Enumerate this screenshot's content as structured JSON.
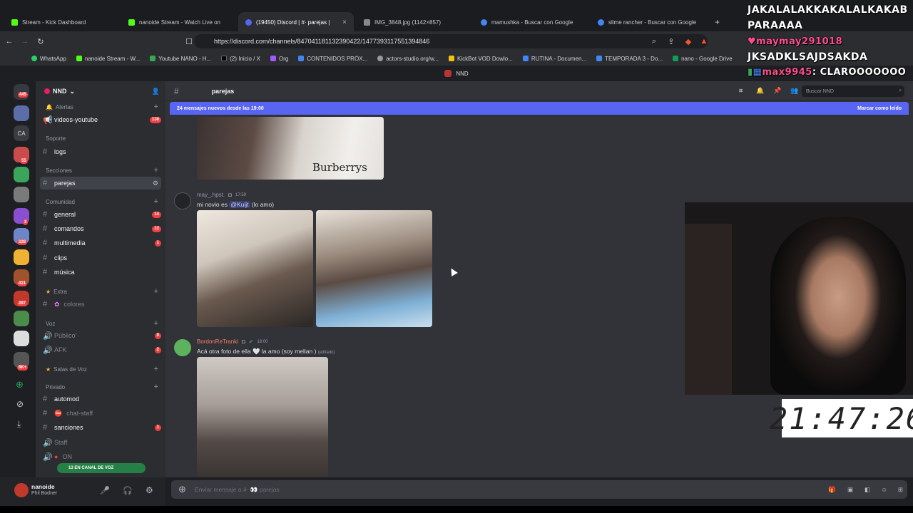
{
  "browser": {
    "tabs": [
      {
        "title": "Stream - Kick Dashboard",
        "color": "#53fc18",
        "active": false
      },
      {
        "title": "nanoide Stream - Watch Live on",
        "color": "#53fc18",
        "active": false
      },
      {
        "title": "(19450) Discord | #· parejas |",
        "color": "#5865f2",
        "active": true
      },
      {
        "title": "IMG_3848.jpg (1142×857)",
        "color": "#888888",
        "active": false
      },
      {
        "title": "mamushka - Buscar con Google",
        "color": "#4285f4",
        "active": false
      },
      {
        "title": "slime rancher - Buscar con Google",
        "color": "#4285f4",
        "active": false
      }
    ],
    "new_tab": "+",
    "url": "https://discord.com/channels/847041181132390422/1477393117551394846",
    "bookmarks": [
      {
        "label": "WhatsApp",
        "color": "#25d366"
      },
      {
        "label": "nanoide Stream - W...",
        "color": "#53fc18"
      },
      {
        "label": "Youtube NANO - H...",
        "color": "#34a853"
      },
      {
        "label": "(2) Inicio / X",
        "color": "#000000"
      },
      {
        "label": "Org",
        "color": "#a259ff"
      },
      {
        "label": "CONTENIDOS PRÓX...",
        "color": "#4285f4"
      },
      {
        "label": "actors-studio.org/w...",
        "color": "#999999"
      },
      {
        "label": "KickBot VOD Dowlo...",
        "color": "#f4c20d"
      },
      {
        "label": "RUTINA - Documen...",
        "color": "#4285f4"
      },
      {
        "label": "TEMPORADA 3 - Do...",
        "color": "#4285f4"
      },
      {
        "label": "nano - Google Drive",
        "color": "#0f9d58"
      }
    ]
  },
  "discord": {
    "top_label": "NND",
    "server_name": "NND",
    "server_badges": [
      "445",
      "55",
      "2",
      "228",
      "431",
      "297",
      "9K+"
    ],
    "categories": {
      "alertas": "Alertas",
      "soporte": "Soporte",
      "secciones": "Secciones",
      "comunidad": "Comunidad",
      "extra": "Extra",
      "voz": "Voz",
      "salas": "Salas de Voz",
      "privado": "Privado"
    },
    "channels": {
      "videos": {
        "label": "videos-youtube",
        "count": "138"
      },
      "logs": {
        "label": "logs"
      },
      "parejas": {
        "label": "parejas"
      },
      "general": {
        "label": "general",
        "count": "14"
      },
      "comandos": {
        "label": "comandos",
        "count": "12"
      },
      "multimedia": {
        "label": "multimedia",
        "count": "1"
      },
      "clips": {
        "label": "clips"
      },
      "musica": {
        "label": "música"
      },
      "colores": {
        "label": "colores"
      },
      "publico": {
        "label": "Público'",
        "count": "9"
      },
      "afk": {
        "label": "AFK",
        "count": "2"
      },
      "automod": {
        "label": "automod"
      },
      "chatstaff": {
        "label": "chat-staff"
      },
      "sanciones": {
        "label": "sanciones",
        "count": "1"
      },
      "staff": {
        "label": "Staff"
      },
      "on": {
        "label": "ON"
      }
    },
    "voice_bar": "13 EN CANAL DE VOZ",
    "user": {
      "name": "nanoide",
      "status": "Phil Bodner"
    },
    "header_channel": "parejas",
    "search_placeholder": "Buscar NND",
    "new_messages": "24 mensajes nuevos desde las 19:00",
    "mark_read": "Marcar como leído",
    "messages": [
      {
        "author": "may_.hpst.",
        "time": "17:59",
        "text_pre": "mi novio es ",
        "mention": "@Kuijt",
        "text_post": " (lo amo)"
      },
      {
        "author": "BordonReTranki",
        "time": "18:00",
        "text": "Acá otra foto de ella 🤍 la amo (soy melian )",
        "edited": "(editado)"
      }
    ],
    "photo_caption": "Burberrys",
    "composer_placeholder": "Enviar mensaje a #· 👀 parejas"
  },
  "overlay": {
    "chat": [
      {
        "user": "",
        "text": "JAKALALAKKAKALALKAKAB"
      },
      {
        "user": "",
        "text": "PARAAAA"
      },
      {
        "user": "maymay291018",
        "text": ""
      },
      {
        "user": "",
        "text": "JKSADKLSAJDSAKDA"
      },
      {
        "user": "max9945",
        "text": ": CLAROOOOOOO"
      }
    ],
    "clock": "21:47:26"
  }
}
